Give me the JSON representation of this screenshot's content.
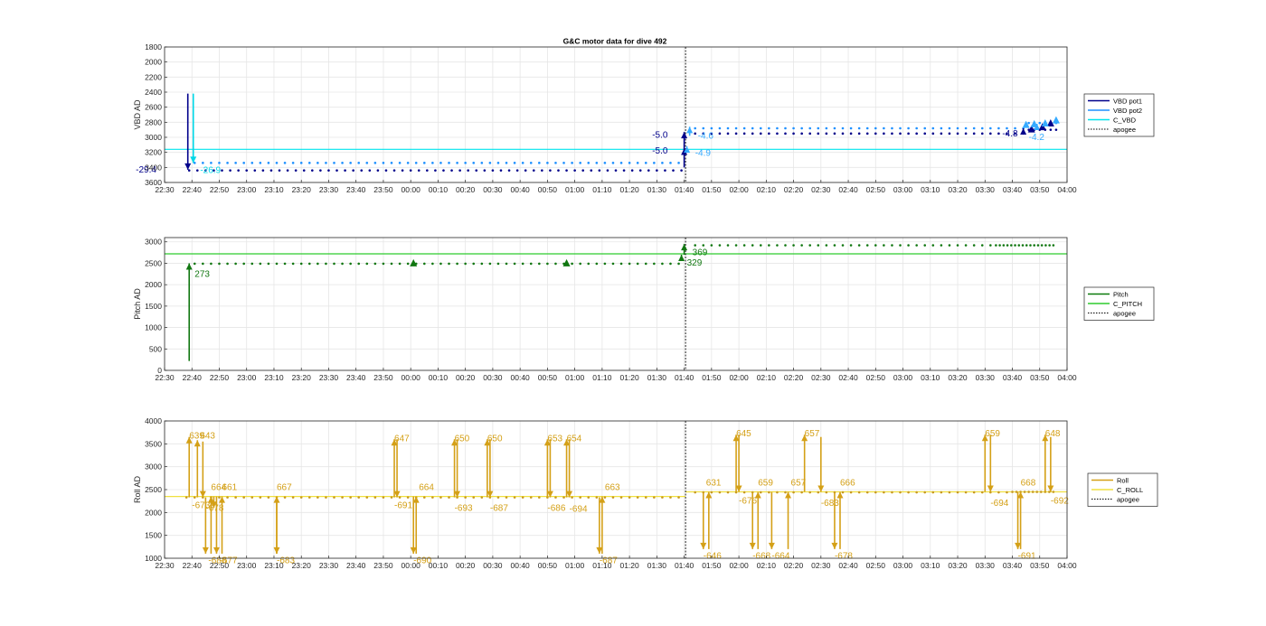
{
  "chart_data": {
    "title": "G&C motor data for dive 492",
    "time_ticks": [
      "22:30",
      "22:40",
      "22:50",
      "23:00",
      "23:10",
      "23:20",
      "23:30",
      "23:40",
      "23:50",
      "00:00",
      "00:10",
      "00:20",
      "00:30",
      "00:40",
      "00:50",
      "01:00",
      "01:10",
      "01:20",
      "01:30",
      "01:40",
      "01:50",
      "02:00",
      "02:10",
      "02:20",
      "02:30",
      "02:40",
      "02:50",
      "03:00",
      "03:10",
      "03:20",
      "03:30",
      "03:40",
      "03:50",
      "04:00"
    ],
    "xlim": [
      0,
      330
    ],
    "apogee_x": 190.5,
    "panels": [
      {
        "type": "scatter",
        "ylabel": "VBD AD",
        "ylim": [
          3600,
          1800
        ],
        "y_reversed": true,
        "yticks": [
          1800,
          2000,
          2200,
          2400,
          2600,
          2800,
          3000,
          3200,
          3400,
          3600
        ],
        "command_value": 3160,
        "legend": [
          {
            "label": "VBD pot1",
            "color": "#00008b",
            "style": "solid"
          },
          {
            "label": "VBD pot2",
            "color": "#1e90ff",
            "style": "solid"
          },
          {
            "label": "C_VBD",
            "color": "#00e5ee",
            "style": "solid"
          },
          {
            "label": "apogee",
            "color": "#000000",
            "style": "dotted"
          }
        ],
        "series": [
          {
            "color": "#00008b",
            "segments": [
              {
                "x0": 9,
                "x1": 190,
                "step": 3,
                "y": 3440
              },
              {
                "x0": 194,
                "x1": 316,
                "step": 3,
                "y": 2950
              },
              {
                "x0": 316,
                "x1": 326,
                "step": 2,
                "y": 2900
              }
            ]
          },
          {
            "color": "#1e90ff",
            "segments": [
              {
                "x0": 11,
                "x1": 190,
                "step": 3,
                "y": 3340
              },
              {
                "x0": 194,
                "x1": 316,
                "step": 3,
                "y": 2880
              },
              {
                "x0": 316,
                "x1": 326,
                "step": 2,
                "y": 2810
              }
            ]
          }
        ],
        "events": [
          {
            "x": 8.5,
            "y0": 2420,
            "y1": 3430,
            "color": "#00008b",
            "label": "-29.4",
            "lx": -3,
            "ly": 3430,
            "anchor": "end"
          },
          {
            "x": 10.5,
            "y0": 2420,
            "y1": 3340,
            "color": "#00d8e8",
            "label": "-26.9",
            "lx": 13,
            "ly": 3440,
            "anchor": "start"
          },
          {
            "x": 190,
            "y0": 3400,
            "y1": 2930,
            "color": "#00008b",
            "label": "-5.0",
            "lx": 184,
            "ly": 2970,
            "anchor": "end"
          },
          {
            "x": 190,
            "y0": 3180,
            "y1": 3150,
            "color": "#00008b",
            "label": "-5.0",
            "lx": 184,
            "ly": 3180,
            "anchor": "end"
          },
          {
            "x": 192,
            "y0": 2980,
            "y1": 2860,
            "color": "#35aaff",
            "label": "-4.6",
            "lx": 195,
            "ly": 2980,
            "anchor": "start"
          },
          {
            "x": 191,
            "y0": 3130,
            "y1": 3120,
            "color": "#35aaff",
            "label": "-4.9",
            "lx": 194,
            "ly": 3210,
            "anchor": "start"
          },
          {
            "x": 314,
            "y0": 2930,
            "y1": 2880,
            "color": "#00008b",
            "label": "-4.8",
            "lx": 312,
            "ly": 2950,
            "anchor": "end"
          },
          {
            "x": 319,
            "y0": 2900,
            "y1": 2820,
            "color": "#35aaff",
            "label": "-4.2",
            "lx": 316,
            "ly": 3000,
            "anchor": "start"
          }
        ],
        "markers": [
          {
            "x": 317,
            "y": 2900,
            "color": "#00008b"
          },
          {
            "x": 321,
            "y": 2870,
            "color": "#00008b"
          },
          {
            "x": 324,
            "y": 2820,
            "color": "#00008b"
          },
          {
            "x": 315,
            "y": 2840,
            "color": "#35aaff"
          },
          {
            "x": 318,
            "y": 2830,
            "color": "#35aaff"
          },
          {
            "x": 322,
            "y": 2820,
            "color": "#35aaff"
          },
          {
            "x": 326,
            "y": 2780,
            "color": "#35aaff"
          }
        ]
      },
      {
        "type": "scatter",
        "ylabel": "Pitch AD",
        "ylim": [
          0,
          3100
        ],
        "y_reversed": false,
        "yticks": [
          0,
          500,
          1000,
          1500,
          2000,
          2500,
          3000
        ],
        "command_value": 2720,
        "legend": [
          {
            "label": "Pitch",
            "color": "#0a7a0a",
            "style": "solid"
          },
          {
            "label": "C_PITCH",
            "color": "#2ecc2e",
            "style": "solid"
          },
          {
            "label": "apogee",
            "color": "#000000",
            "style": "dotted"
          }
        ],
        "series": [
          {
            "color": "#117711",
            "segments": [
              {
                "x0": 11,
                "x1": 190,
                "step": 3,
                "y": 2490
              },
              {
                "x0": 194,
                "x1": 304,
                "step": 3,
                "y": 2920
              },
              {
                "x0": 304,
                "x1": 326,
                "step": 1.4,
                "y": 2920
              }
            ]
          }
        ],
        "events": [
          {
            "x": 9,
            "y0": 220,
            "y1": 2500,
            "color": "#117711",
            "label": "273",
            "lx": 11,
            "ly": 2250,
            "anchor": "start"
          },
          {
            "x": 189,
            "y0": 2620,
            "y1": 2700,
            "color": "#117711",
            "label": "329",
            "lx": 191,
            "ly": 2510,
            "anchor": "start"
          },
          {
            "x": 190,
            "y0": 2700,
            "y1": 2950,
            "color": "#117711",
            "label": "369",
            "lx": 193,
            "ly": 2750,
            "anchor": "start"
          }
        ],
        "markers": [
          {
            "x": 91,
            "y": 2490,
            "color": "#117711"
          },
          {
            "x": 147,
            "y": 2490,
            "color": "#117711"
          }
        ]
      },
      {
        "type": "scatter",
        "ylabel": "Roll AD",
        "ylim": [
          1000,
          4000
        ],
        "y_reversed": false,
        "yticks": [
          1000,
          1500,
          2000,
          2500,
          3000,
          3500,
          4000
        ],
        "command_value": 2350,
        "command_value_after": 2450,
        "legend": [
          {
            "label": "Roll",
            "color": "#d4a017",
            "style": "solid"
          },
          {
            "label": "C_ROLL",
            "color": "#f0e040",
            "style": "solid"
          },
          {
            "label": "apogee",
            "color": "#000000",
            "style": "dotted"
          }
        ],
        "series": [
          {
            "color": "#c89a20",
            "segments": [
              {
                "x0": 8,
                "x1": 190,
                "step": 3,
                "y": 2330
              },
              {
                "x0": 194,
                "x1": 310,
                "step": 3,
                "y": 2440
              },
              {
                "x0": 310,
                "x1": 326,
                "step": 1.5,
                "y": 2450
              }
            ]
          }
        ],
        "events": [
          {
            "x": 9,
            "y0": 2330,
            "y1": 3650,
            "color": "#d4a017",
            "label": "639",
            "lx": 9,
            "ly": 3670,
            "anchor": "start"
          },
          {
            "x": 12,
            "y0": 2330,
            "y1": 3580,
            "color": "#d4a017",
            "label": "643",
            "lx": 13,
            "ly": 3670,
            "anchor": "start"
          },
          {
            "x": 14,
            "y0": 3550,
            "y1": 2330,
            "color": "#d4a017",
            "label": "-673",
            "lx": 10,
            "ly": 2150,
            "anchor": "start"
          },
          {
            "x": 15,
            "y0": 2330,
            "y1": 1100,
            "color": "#d4a017",
            "label": "-688",
            "lx": 16,
            "ly": 950,
            "anchor": "start"
          },
          {
            "x": 17,
            "y0": 1100,
            "y1": 2350,
            "color": "#d4a017",
            "label": "664",
            "lx": 17,
            "ly": 2550,
            "anchor": "start"
          },
          {
            "x": 18,
            "y0": 2350,
            "y1": 2100,
            "color": "#d4a017",
            "label": "-678",
            "lx": 15,
            "ly": 2100,
            "anchor": "start"
          },
          {
            "x": 19,
            "y0": 2350,
            "y1": 1100,
            "color": "#d4a017",
            "label": "-677",
            "lx": 20,
            "ly": 950,
            "anchor": "start"
          },
          {
            "x": 21,
            "y0": 1100,
            "y1": 2350,
            "color": "#d4a017",
            "label": "661",
            "lx": 21,
            "ly": 2550,
            "anchor": "start"
          },
          {
            "x": 41,
            "y0": 1100,
            "y1": 2350,
            "color": "#d4a017",
            "label": "667",
            "lx": 41,
            "ly": 2550,
            "anchor": "start"
          },
          {
            "x": 41,
            "y0": 2350,
            "y1": 1100,
            "color": "#d4a017",
            "label": "-683",
            "lx": 41,
            "ly": 950,
            "anchor": "start"
          },
          {
            "x": 84,
            "y0": 2330,
            "y1": 3600,
            "color": "#d4a017",
            "label": "647",
            "lx": 84,
            "ly": 3620,
            "anchor": "start"
          },
          {
            "x": 85,
            "y0": 3600,
            "y1": 2330,
            "color": "#d4a017",
            "label": "-691",
            "lx": 84,
            "ly": 2150,
            "anchor": "start"
          },
          {
            "x": 91,
            "y0": 2350,
            "y1": 1100,
            "color": "#d4a017",
            "label": "-690",
            "lx": 91,
            "ly": 950,
            "anchor": "start"
          },
          {
            "x": 92,
            "y0": 1100,
            "y1": 2350,
            "color": "#d4a017",
            "label": "664",
            "lx": 93,
            "ly": 2550,
            "anchor": "start"
          },
          {
            "x": 106,
            "y0": 2330,
            "y1": 3600,
            "color": "#d4a017",
            "label": "650",
            "lx": 106,
            "ly": 3620,
            "anchor": "start"
          },
          {
            "x": 107,
            "y0": 3600,
            "y1": 2330,
            "color": "#d4a017",
            "label": "-693",
            "lx": 106,
            "ly": 2100,
            "anchor": "start"
          },
          {
            "x": 118,
            "y0": 2330,
            "y1": 3600,
            "color": "#d4a017",
            "label": "650",
            "lx": 118,
            "ly": 3620,
            "anchor": "start"
          },
          {
            "x": 119,
            "y0": 3600,
            "y1": 2330,
            "color": "#d4a017",
            "label": "-687",
            "lx": 119,
            "ly": 2100,
            "anchor": "start"
          },
          {
            "x": 140,
            "y0": 2330,
            "y1": 3600,
            "color": "#d4a017",
            "label": "653",
            "lx": 140,
            "ly": 3620,
            "anchor": "start"
          },
          {
            "x": 141,
            "y0": 3600,
            "y1": 2330,
            "color": "#d4a017",
            "label": "-686",
            "lx": 140,
            "ly": 2100,
            "anchor": "start"
          },
          {
            "x": 147,
            "y0": 2330,
            "y1": 3600,
            "color": "#d4a017",
            "label": "654",
            "lx": 147,
            "ly": 3620,
            "anchor": "start"
          },
          {
            "x": 148,
            "y0": 3600,
            "y1": 2330,
            "color": "#d4a017",
            "label": "-694",
            "lx": 148,
            "ly": 2080,
            "anchor": "start"
          },
          {
            "x": 159,
            "y0": 2330,
            "y1": 1100,
            "color": "#d4a017",
            "label": "-687",
            "lx": 159,
            "ly": 950,
            "anchor": "start"
          },
          {
            "x": 160,
            "y0": 1100,
            "y1": 2350,
            "color": "#d4a017",
            "label": "663",
            "lx": 161,
            "ly": 2550,
            "anchor": "start"
          },
          {
            "x": 197,
            "y0": 2450,
            "y1": 1200,
            "color": "#d4a017",
            "label": "-646",
            "lx": 197,
            "ly": 1050,
            "anchor": "start"
          },
          {
            "x": 199,
            "y0": 1200,
            "y1": 2450,
            "color": "#d4a017",
            "label": "631",
            "lx": 198,
            "ly": 2650,
            "anchor": "start"
          },
          {
            "x": 209,
            "y0": 2450,
            "y1": 3700,
            "color": "#d4a017",
            "label": "645",
            "lx": 209,
            "ly": 3720,
            "anchor": "start"
          },
          {
            "x": 210,
            "y0": 3700,
            "y1": 2450,
            "color": "#d4a017",
            "label": "-676",
            "lx": 210,
            "ly": 2250,
            "anchor": "start"
          },
          {
            "x": 215,
            "y0": 2450,
            "y1": 1200,
            "color": "#d4a017",
            "label": "-668",
            "lx": 215,
            "ly": 1050,
            "anchor": "start"
          },
          {
            "x": 217,
            "y0": 1200,
            "y1": 2450,
            "color": "#d4a017",
            "label": "659",
            "lx": 217,
            "ly": 2650,
            "anchor": "start"
          },
          {
            "x": 222,
            "y0": 2450,
            "y1": 1200,
            "color": "#d4a017",
            "label": "-664",
            "lx": 222,
            "ly": 1050,
            "anchor": "start"
          },
          {
            "x": 228,
            "y0": 1200,
            "y1": 2450,
            "color": "#d4a017",
            "label": "657",
            "lx": 229,
            "ly": 2650,
            "anchor": "start"
          },
          {
            "x": 234,
            "y0": 2450,
            "y1": 3700,
            "color": "#d4a017",
            "label": "657",
            "lx": 234,
            "ly": 3720,
            "anchor": "start"
          },
          {
            "x": 240,
            "y0": 3650,
            "y1": 2450,
            "color": "#d4a017",
            "label": "-683",
            "lx": 240,
            "ly": 2200,
            "anchor": "start"
          },
          {
            "x": 245,
            "y0": 2450,
            "y1": 1200,
            "color": "#d4a017",
            "label": "-678",
            "lx": 245,
            "ly": 1050,
            "anchor": "start"
          },
          {
            "x": 247,
            "y0": 1200,
            "y1": 2450,
            "color": "#d4a017",
            "label": "666",
            "lx": 247,
            "ly": 2650,
            "anchor": "start"
          },
          {
            "x": 300,
            "y0": 2450,
            "y1": 3700,
            "color": "#d4a017",
            "label": "659",
            "lx": 300,
            "ly": 3720,
            "anchor": "start"
          },
          {
            "x": 302,
            "y0": 3700,
            "y1": 2450,
            "color": "#d4a017",
            "label": "-694",
            "lx": 302,
            "ly": 2200,
            "anchor": "start"
          },
          {
            "x": 312,
            "y0": 2450,
            "y1": 1200,
            "color": "#d4a017",
            "label": "-691",
            "lx": 312,
            "ly": 1050,
            "anchor": "start"
          },
          {
            "x": 313,
            "y0": 1200,
            "y1": 2450,
            "color": "#d4a017",
            "label": "668",
            "lx": 313,
            "ly": 2650,
            "anchor": "start"
          },
          {
            "x": 322,
            "y0": 2450,
            "y1": 3700,
            "color": "#d4a017",
            "label": "648",
            "lx": 322,
            "ly": 3720,
            "anchor": "start"
          },
          {
            "x": 324,
            "y0": 3650,
            "y1": 2450,
            "color": "#d4a017",
            "label": "-692",
            "lx": 324,
            "ly": 2250,
            "anchor": "start"
          }
        ],
        "markers": []
      }
    ]
  }
}
